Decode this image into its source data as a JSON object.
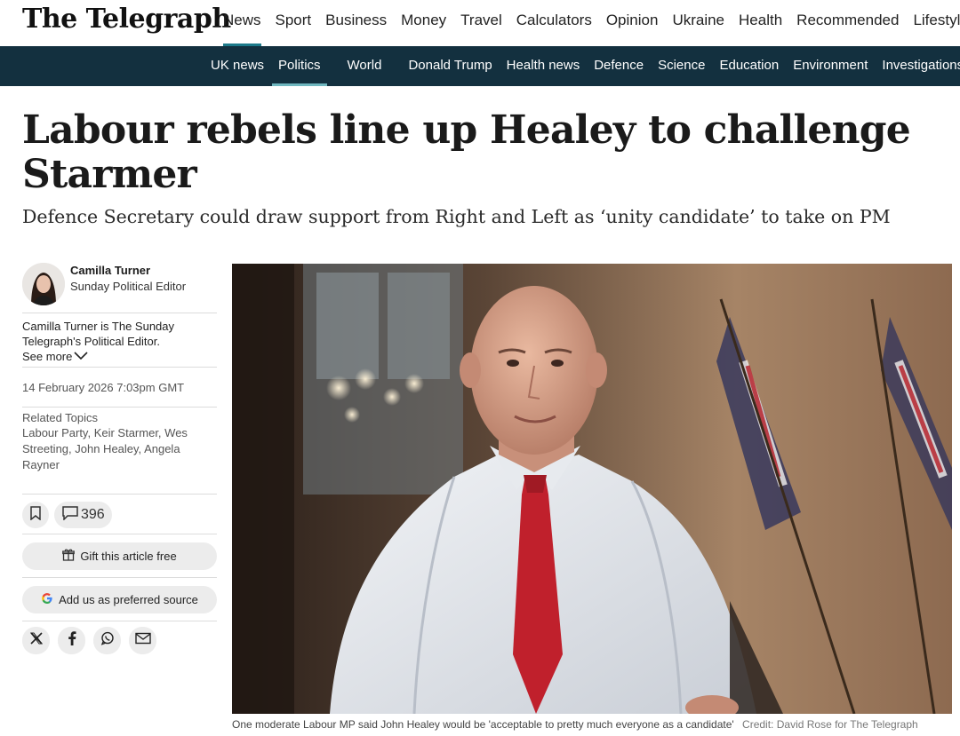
{
  "brand": {
    "logo": "The Telegraph"
  },
  "main_nav": [
    {
      "label": "News",
      "active": true
    },
    {
      "label": "Sport"
    },
    {
      "label": "Business"
    },
    {
      "label": "Money"
    },
    {
      "label": "Travel"
    },
    {
      "label": "Calculators"
    },
    {
      "label": "Opinion"
    },
    {
      "label": "Ukraine"
    },
    {
      "label": "Health"
    },
    {
      "label": "Recommended"
    },
    {
      "label": "Lifestyle"
    }
  ],
  "sub_nav": [
    {
      "label": "UK news"
    },
    {
      "label": "Politics",
      "active": true
    },
    {
      "label": "World"
    },
    {
      "label": "Donald Trump"
    },
    {
      "label": "Health news"
    },
    {
      "label": "Defence"
    },
    {
      "label": "Science"
    },
    {
      "label": "Education"
    },
    {
      "label": "Environment"
    },
    {
      "label": "Investigations"
    }
  ],
  "article": {
    "headline": "Labour rebels line up Healey to challenge Starmer",
    "standfirst": "Defence Secretary could draw support from Right and Left as ‘unity candidate’ to take on PM",
    "author": {
      "name": "Camilla Turner",
      "role": "Sunday Political Editor",
      "bio": "Camilla Turner is The Sunday Telegraph's Political Editor.",
      "see_more": "See more"
    },
    "date": "14 February 2026 7:03pm GMT",
    "related_title": "Related Topics",
    "related_topics": "Labour Party, Keir Starmer, Wes Streeting, John Healey, Angela Rayner",
    "comment_count": "396",
    "gift_label": "Gift this article free",
    "preferred_source_label": "Add us as preferred source",
    "caption": "One moderate Labour MP said John Healey would be 'acceptable to pretty much everyone as a candidate'",
    "credit": "Credit: David Rose for The Telegraph"
  },
  "colors": {
    "nav_dark": "#13303f",
    "accent_teal": "#1d7a8a",
    "tie_red": "#c0202c"
  },
  "icons": [
    "bookmark-icon",
    "comment-icon",
    "gift-icon",
    "google-icon",
    "x-icon",
    "facebook-icon",
    "whatsapp-icon",
    "email-icon",
    "chevron-down-icon"
  ]
}
